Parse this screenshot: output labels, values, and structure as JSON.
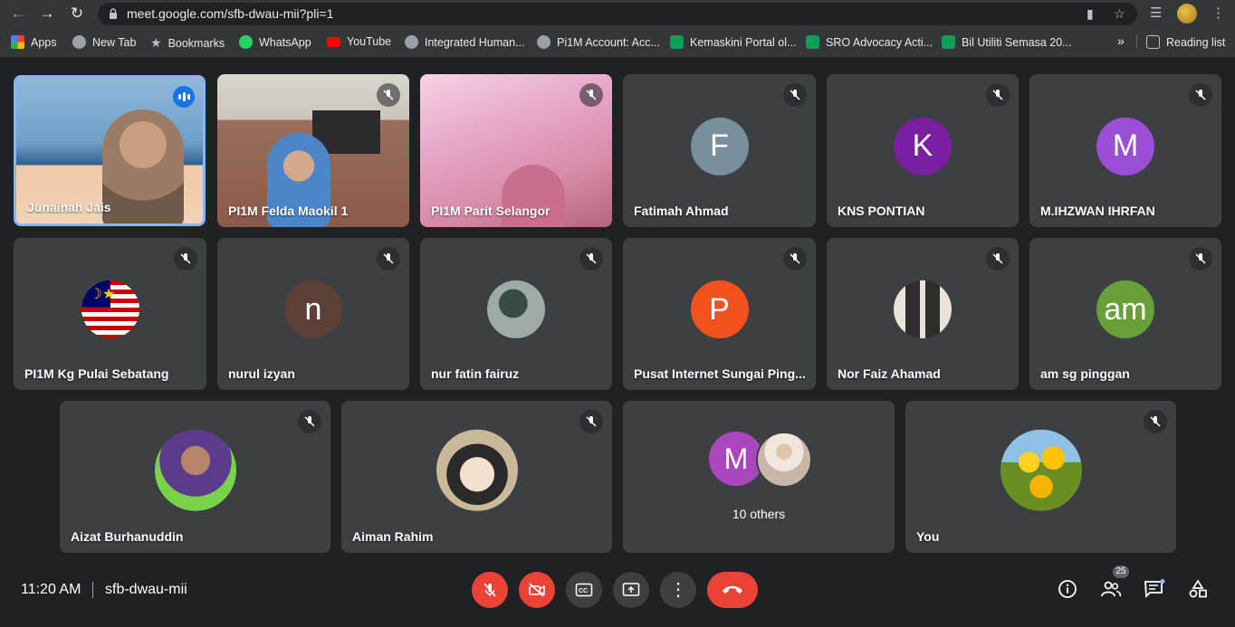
{
  "browser": {
    "url": "meet.google.com/sfb-dwau-mii?pli=1",
    "bookmarks": [
      {
        "label": "Apps"
      },
      {
        "label": "New Tab"
      },
      {
        "label": "Bookmarks"
      },
      {
        "label": "WhatsApp"
      },
      {
        "label": "YouTube"
      },
      {
        "label": "Integrated Human..."
      },
      {
        "label": "Pi1M Account: Acc..."
      },
      {
        "label": "Kemaskini Portal ol..."
      },
      {
        "label": "SRO Advocacy Acti..."
      },
      {
        "label": "Bil Utiliti Semasa 20..."
      }
    ],
    "more_bookmarks": "»",
    "reading_list": "Reading list"
  },
  "tiles": [
    {
      "name": "Junainah Jais"
    },
    {
      "name": "PI1M Felda Maokil 1"
    },
    {
      "name": "PI1M Parit Selangor"
    },
    {
      "name": "Fatimah Ahmad",
      "initial": "F",
      "color": "#78909c"
    },
    {
      "name": "KNS PONTIAN",
      "initial": "K",
      "color": "#7b1fa2"
    },
    {
      "name": "M.IHZWAN IHRFAN",
      "initial": "M",
      "color": "#9c4fd6"
    },
    {
      "name": "PI1M Kg Pulai Sebatang"
    },
    {
      "name": "nurul izyan",
      "initial": "n",
      "color": "#5d4037"
    },
    {
      "name": "nur fatin fairuz"
    },
    {
      "name": "Pusat Internet Sungai Ping...",
      "initial": "P",
      "color": "#f4511e"
    },
    {
      "name": "Nor Faiz Ahamad"
    },
    {
      "name": "am sg pinggan",
      "initial": "am",
      "color": "#689f38"
    },
    {
      "name": "Aizat Burhanuddin"
    },
    {
      "name": "Aiman Rahim"
    },
    {
      "name": "10 others",
      "initial": "M",
      "color": "#ab47bc"
    },
    {
      "name": "You"
    }
  ],
  "footer": {
    "time": "11:20 AM",
    "meeting_code": "sfb-dwau-mii",
    "participants_count": "25"
  },
  "colors": {
    "end_call": "#ea4335",
    "speaking": "#1a73e8",
    "tile": "#3c4043"
  }
}
